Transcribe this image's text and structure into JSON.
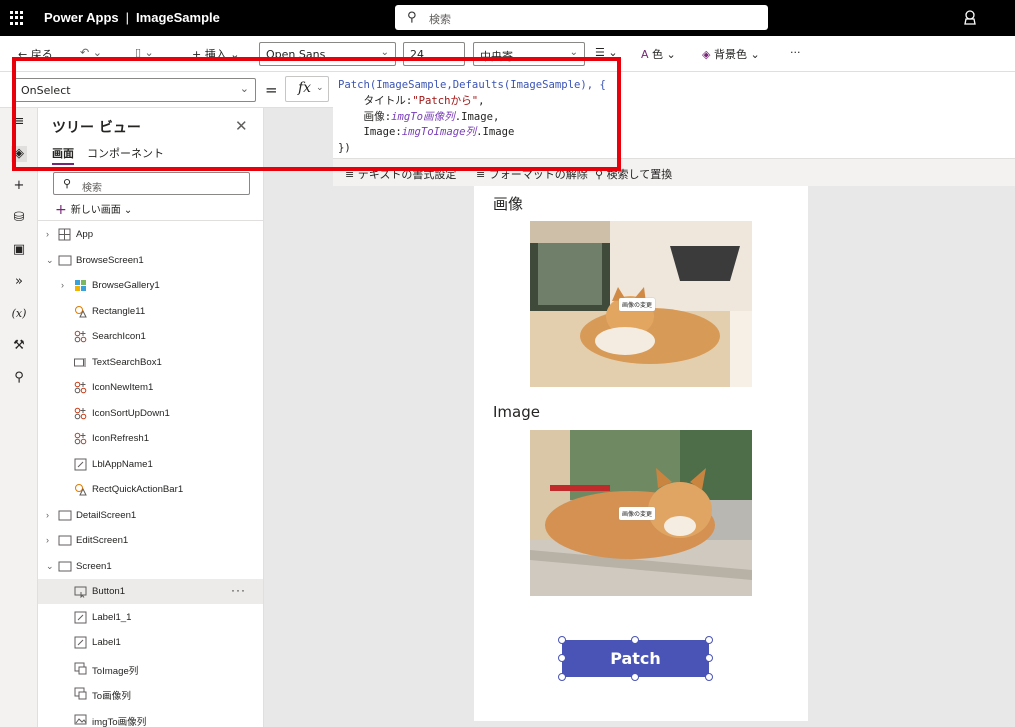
{
  "topbar": {
    "app_name": "Power Apps",
    "separator": "|",
    "file_name": "ImageSample",
    "search_placeholder": "検索"
  },
  "ribbon": {
    "back_label": "戻る",
    "insert_label": "挿入",
    "font_value": "Open Sans",
    "size_value": "24",
    "align_value": "中央寄",
    "color_label": "色",
    "fill_label": "背景色",
    "more_label": "···"
  },
  "formula": {
    "property": "OnSelect",
    "equals": "=",
    "fx": "fx",
    "lines": [
      {
        "parts": [
          {
            "t": "Patch(ImageSample,Defaults(ImageSample), {",
            "c": "fn"
          }
        ]
      },
      {
        "parts": [
          {
            "t": "    タイトル:",
            "c": ""
          },
          {
            "t": "\"Patchから\"",
            "c": "str"
          },
          {
            "t": ",",
            "c": ""
          }
        ]
      },
      {
        "parts": [
          {
            "t": "    画像:",
            "c": ""
          },
          {
            "t": "imgTo画像列",
            "c": "id"
          },
          {
            "t": ".Image,",
            "c": ""
          }
        ]
      },
      {
        "parts": [
          {
            "t": "    Image:",
            "c": ""
          },
          {
            "t": "imgToImage列",
            "c": "id"
          },
          {
            "t": ".Image",
            "c": ""
          }
        ]
      },
      {
        "parts": [
          {
            "t": "})",
            "c": ""
          }
        ]
      }
    ]
  },
  "format_bar": {
    "format_text": "テキストの書式設定",
    "remove_format": "フォーマットの解除",
    "find_replace": "検索して置換"
  },
  "tree": {
    "title": "ツリー ビュー",
    "tab_screens": "画面",
    "tab_components": "コンポーネント",
    "search_placeholder": "検索",
    "new_screen": "新しい画面",
    "nodes": [
      {
        "label": "App",
        "indent": 0,
        "twisty": "›",
        "icon": "grid-icon"
      },
      {
        "label": "BrowseScreen1",
        "indent": 0,
        "twisty": "⌄",
        "icon": "screen-icon"
      },
      {
        "label": "BrowseGallery1",
        "indent": 1,
        "twisty": "›",
        "icon": "gallery-icon"
      },
      {
        "label": "Rectangle11",
        "indent": 2,
        "twisty": "",
        "icon": "shape-icon"
      },
      {
        "label": "SearchIcon1",
        "indent": 2,
        "twisty": "",
        "icon": "icon-control-icon"
      },
      {
        "label": "TextSearchBox1",
        "indent": 2,
        "twisty": "",
        "icon": "textinput-icon"
      },
      {
        "label": "IconNewItem1",
        "indent": 2,
        "twisty": "",
        "icon": "icon-control-icon"
      },
      {
        "label": "IconSortUpDown1",
        "indent": 2,
        "twisty": "",
        "icon": "icon-control-icon"
      },
      {
        "label": "IconRefresh1",
        "indent": 2,
        "twisty": "",
        "icon": "icon-control-icon"
      },
      {
        "label": "LblAppName1",
        "indent": 2,
        "twisty": "",
        "icon": "label-icon"
      },
      {
        "label": "RectQuickActionBar1",
        "indent": 2,
        "twisty": "",
        "icon": "shape-icon"
      },
      {
        "label": "DetailScreen1",
        "indent": 0,
        "twisty": "›",
        "icon": "screen-icon"
      },
      {
        "label": "EditScreen1",
        "indent": 0,
        "twisty": "›",
        "icon": "screen-icon"
      },
      {
        "label": "Screen1",
        "indent": 0,
        "twisty": "⌄",
        "icon": "screen-icon"
      },
      {
        "label": "Button1",
        "indent": 2,
        "twisty": "",
        "icon": "button-icon",
        "selected": true,
        "more": "···"
      },
      {
        "label": "Label1_1",
        "indent": 2,
        "twisty": "",
        "icon": "label-icon"
      },
      {
        "label": "Label1",
        "indent": 2,
        "twisty": "",
        "icon": "label-icon"
      },
      {
        "label": "ToImage列",
        "indent": 2,
        "twisty": "",
        "icon": "addpicture-icon"
      },
      {
        "label": "To画像列",
        "indent": 2,
        "twisty": "",
        "icon": "addpicture-icon"
      },
      {
        "label": "imgTo画像列",
        "indent": 2,
        "twisty": "",
        "icon": "image-icon"
      }
    ]
  },
  "canvas": {
    "label_japanese": "画像",
    "label_english": "Image",
    "image_tag_1": "画像の変更",
    "image_tag_2": "画像の変更",
    "button_label": "Patch"
  },
  "colors": {
    "accent": "#742774",
    "button": "#4a54b6",
    "highlight_box": "#e8000a"
  }
}
